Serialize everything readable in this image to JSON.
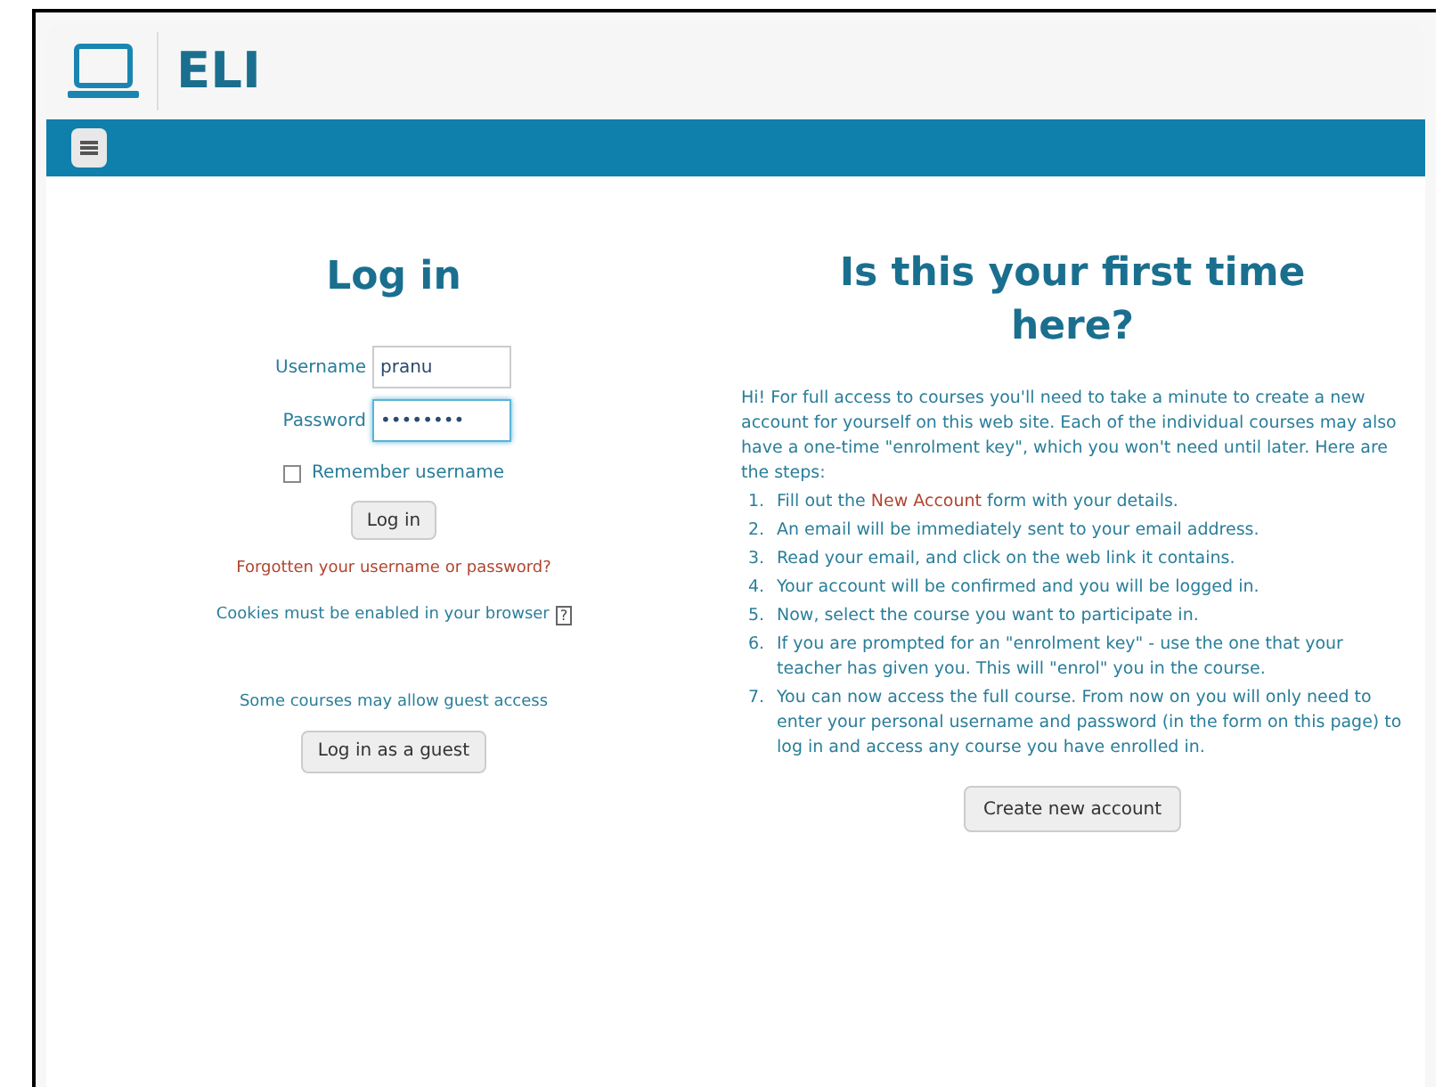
{
  "header": {
    "site_name": "ELI"
  },
  "login": {
    "title": "Log in",
    "fields": [
      {
        "label": "Username",
        "value": "pranu",
        "focused": false
      },
      {
        "label": "Password",
        "value": "••••••••",
        "focused": true
      }
    ],
    "remember": {
      "label": "Remember username",
      "checked": false
    },
    "submit": "Log in",
    "forgot_link": "Forgotten your username or password?",
    "cookies_note": "Cookies must be enabled in your browser",
    "help_icon": "?",
    "guest_note": "Some courses may allow guest access",
    "guest_button": "Log in as a guest"
  },
  "signup": {
    "title": "Is this your first time here?",
    "intro": "Hi! For full access to courses you'll need to take a minute to create a new account for yourself on this web site. Each of the individual courses may also have a one-time \"enrolment key\", which you won't need until later. Here are the steps:",
    "steps": [
      {
        "number": "1.",
        "before": "Fill out the ",
        "link": "New Account",
        "after": " form with your details."
      },
      {
        "number": "2.",
        "before": "An email will be immediately sent to your email address."
      },
      {
        "number": "3.",
        "before": "Read your email, and click on the web link it contains."
      },
      {
        "number": "4.",
        "before": "Your account will be confirmed and you will be logged in."
      },
      {
        "number": "5.",
        "before": "Now, select the course you want to participate in."
      },
      {
        "number": "6.",
        "before": "If you are prompted for an \"enrolment key\" - use the one that your teacher has given you. This will \"enrol\" you in the course."
      },
      {
        "number": "7.",
        "before": "You can now access the full course. From now on you will only need to enter your personal username and password (in the form on this page) to log in and access any course you have enrolled in."
      }
    ],
    "button": "Create new account"
  }
}
